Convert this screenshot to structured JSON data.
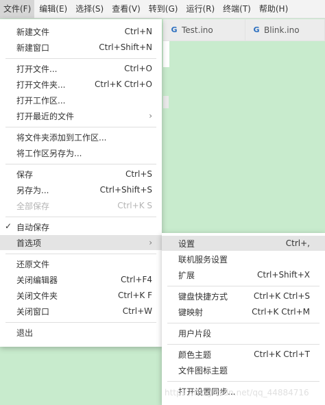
{
  "menubar": {
    "items": [
      "文件(F)",
      "编辑(E)",
      "选择(S)",
      "查看(V)",
      "转到(G)",
      "运行(R)",
      "终端(T)",
      "帮助(H)"
    ]
  },
  "tabs": [
    {
      "label": "Test.ino",
      "icon": "c-file-icon"
    },
    {
      "label": "Blink.ino",
      "icon": "c-file-icon"
    }
  ],
  "file_menu": {
    "new_file": {
      "label": "新建文件",
      "shortcut": "Ctrl+N"
    },
    "new_window": {
      "label": "新建窗口",
      "shortcut": "Ctrl+Shift+N"
    },
    "open_file": {
      "label": "打开文件...",
      "shortcut": "Ctrl+O"
    },
    "open_folder": {
      "label": "打开文件夹...",
      "shortcut": "Ctrl+K Ctrl+O"
    },
    "open_workspace": {
      "label": "打开工作区..."
    },
    "open_recent": {
      "label": "打开最近的文件"
    },
    "add_folder_to_workspace": {
      "label": "将文件夹添加到工作区..."
    },
    "save_workspace_as": {
      "label": "将工作区另存为..."
    },
    "save": {
      "label": "保存",
      "shortcut": "Ctrl+S"
    },
    "save_as": {
      "label": "另存为...",
      "shortcut": "Ctrl+Shift+S"
    },
    "save_all": {
      "label": "全部保存",
      "shortcut": "Ctrl+K S"
    },
    "auto_save": {
      "label": "自动保存",
      "check": "✓"
    },
    "preferences": {
      "label": "首选项"
    },
    "revert_file": {
      "label": "还原文件"
    },
    "close_editor": {
      "label": "关闭编辑器",
      "shortcut": "Ctrl+F4"
    },
    "close_folder": {
      "label": "关闭文件夹",
      "shortcut": "Ctrl+K F"
    },
    "close_window": {
      "label": "关闭窗口",
      "shortcut": "Ctrl+W"
    },
    "exit": {
      "label": "退出"
    }
  },
  "preferences_menu": {
    "settings": {
      "label": "设置",
      "shortcut": "Ctrl+,"
    },
    "online_services": {
      "label": "联机服务设置"
    },
    "extensions": {
      "label": "扩展",
      "shortcut": "Ctrl+Shift+X"
    },
    "keyboard_shortcuts": {
      "label": "键盘快捷方式",
      "shortcut": "Ctrl+K Ctrl+S"
    },
    "keymaps": {
      "label": "键映射",
      "shortcut": "Ctrl+K Ctrl+M"
    },
    "user_snippets": {
      "label": "用户片段"
    },
    "color_theme": {
      "label": "颜色主题",
      "shortcut": "Ctrl+K Ctrl+T"
    },
    "file_icon_theme": {
      "label": "文件图标主题"
    },
    "settings_sync": {
      "label": "打开设置同步..."
    }
  },
  "watermark": "https://blog.csdn.net/qq_44884716",
  "colors": {
    "editor_background": "#c8ebcd",
    "menu_background": "#ffffff",
    "menu_highlight": "#e4e4e4",
    "menubar_background": "#f3f3f3",
    "disabled_text": "#b4b4b4"
  }
}
